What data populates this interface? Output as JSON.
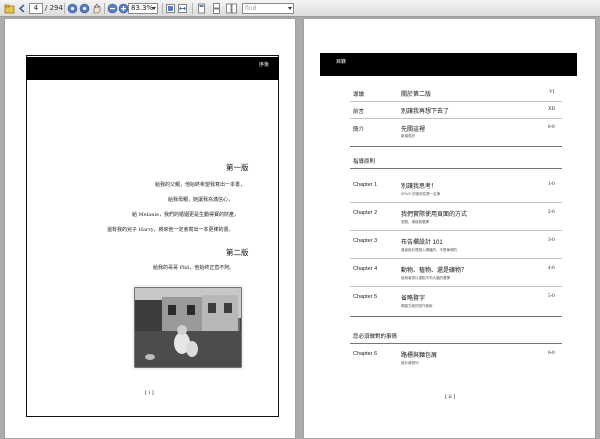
{
  "toolbar": {
    "current_page": "4",
    "total_pages": "/ 294",
    "zoom": "83.3%",
    "find_placeholder": "find"
  },
  "left_page": {
    "header_label": "序後",
    "lines_1": [
      "給我的父親，他始終希望我寫出一本書，",
      "給我母親，她讓我充滿信心，",
      "給 Melanie，我們的婚姻更是生動得寶的財產，",
      "還有我的兒子 Harry，將來他一定會寫出一本更棒的書。"
    ],
    "heading_1": "第一版",
    "heading_2": "第二版",
    "lines_2": [
      "給我的哥哥 Phil，他始終正直不阿。"
    ],
    "page_number": "[ i ]"
  },
  "right_page": {
    "header_label": "目錄",
    "front_matter": [
      {
        "label": "導讀",
        "title": "關於第二版",
        "subtitle": "",
        "page": "VI"
      },
      {
        "label": "前言",
        "title": "別讓我再想下去了",
        "subtitle": "",
        "page": "XII"
      },
      {
        "label": "簡介",
        "title": "先關這裡",
        "subtitle": "新增表訳",
        "page": "0-0"
      }
    ],
    "section_1": "指導原則",
    "chapters_1": [
      {
        "label": "Chapter 1",
        "title": "別讓我思考！",
        "subtitle": "KRUG 的使用性第一定律",
        "page": "1-0"
      },
      {
        "label": "Chapter 2",
        "title": "我們實際使用頁面的方式",
        "subtitle": "瀏覽、滿就與選擇",
        "page": "2-0"
      },
      {
        "label": "Chapter 3",
        "title": "布告欄設計 101",
        "subtitle": "頁面設計是融入傳播的，不是單調的",
        "page": "3-0"
      },
      {
        "label": "Chapter 4",
        "title": "動物、植物、還是礦物？",
        "subtitle": "使用者很以重點不同大腦的選擇",
        "page": "4-0"
      },
      {
        "label": "Chapter 5",
        "title": "省略贅字",
        "subtitle": "網頁文案的寫作藝術",
        "page": "5-0"
      }
    ],
    "section_2": "您必須做對的事情",
    "chapters_2": [
      {
        "label": "Chapter 6",
        "title": "路標與麵包屑",
        "subtitle": "設計導覽列",
        "page": "6-0"
      }
    ],
    "page_number": "[ ii ]"
  }
}
